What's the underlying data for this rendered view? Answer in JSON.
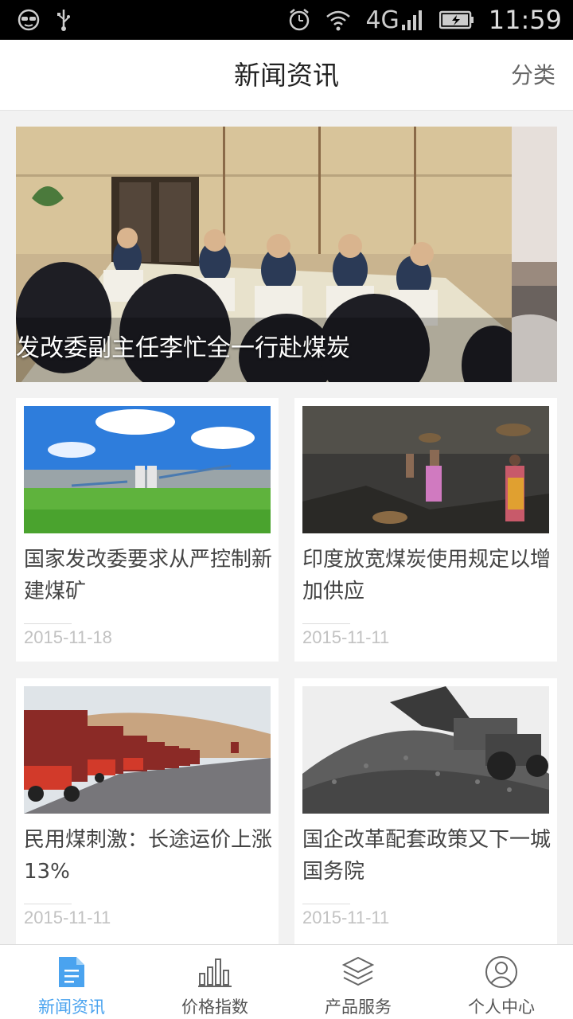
{
  "status_bar": {
    "network": "4G",
    "time": "11:59",
    "icons": [
      "cat-face-icon",
      "usb-icon",
      "alarm-icon",
      "wifi-icon",
      "signal-icon",
      "battery-icon"
    ]
  },
  "header": {
    "title": "新闻资讯",
    "category_label": "分类"
  },
  "banner": {
    "caption": "发改委副主任李忙全一行赴煤炭"
  },
  "news": [
    {
      "title": "国家发改委要求从严控制新建煤矿",
      "date": "2015-11-18"
    },
    {
      "title": "印度放宽煤炭使用规定以增加供应",
      "date": "2015-11-11"
    },
    {
      "title": "民用煤刺激：长途运价上涨13%",
      "date": "2015-11-11"
    },
    {
      "title": "国企改革配套政策又下一城 国务院",
      "date": "2015-11-11"
    }
  ],
  "bottom_nav": {
    "items": [
      {
        "label": "新闻资讯",
        "icon": "document-icon",
        "active": true
      },
      {
        "label": "价格指数",
        "icon": "bar-chart-icon",
        "active": false
      },
      {
        "label": "产品服务",
        "icon": "layers-icon",
        "active": false
      },
      {
        "label": "个人中心",
        "icon": "user-icon",
        "active": false
      }
    ]
  },
  "colors": {
    "accent": "#4aa3ef",
    "background": "#f2f2f2",
    "date_text": "#c2c2c2"
  }
}
